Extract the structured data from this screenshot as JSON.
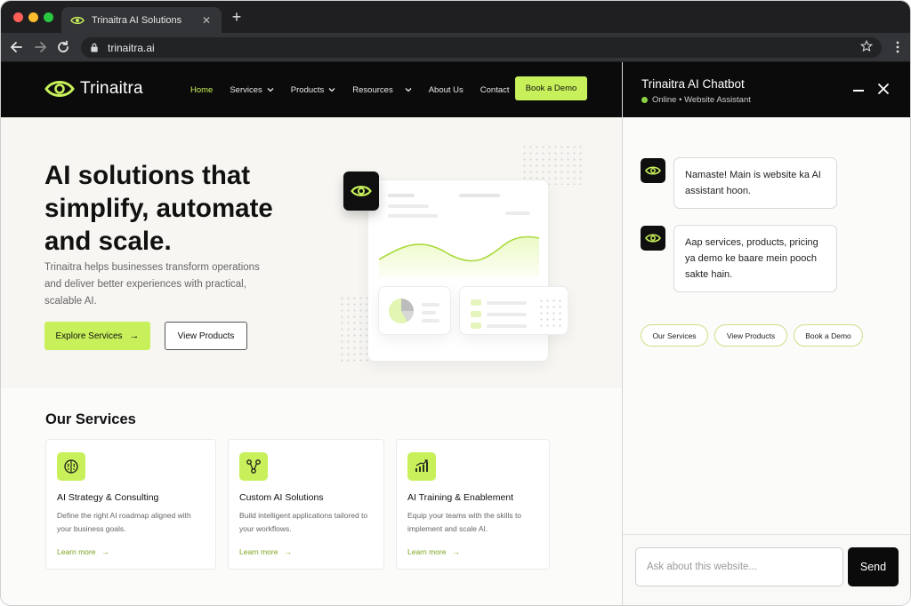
{
  "browser": {
    "tab_title": "Trinaitra AI Solutions",
    "tab_close": "✕",
    "new_tab": "+",
    "url": "trinaitra.ai",
    "icons": [
      "back-icon",
      "forward-icon",
      "reload-icon",
      "lock-icon",
      "star-icon",
      "more-icon"
    ]
  },
  "site": {
    "brand": "Trinaitra",
    "accent_color": "#c8f05a",
    "nav": {
      "home": "Home",
      "services": "Services",
      "products": "Products",
      "resources": "Resources",
      "about": "About Us",
      "contact": "Contact"
    },
    "cta": "Book a Demo"
  },
  "hero": {
    "title": "AI solutions that simplify, automate and scale.",
    "subtitle": "Trinaitra helps businesses transform operations and deliver better experiences with practical, scalable AI.",
    "primary_button": "Explore Services",
    "primary_arrow": "→",
    "secondary_button": "View Products"
  },
  "services": {
    "heading": "Our Services",
    "items": [
      {
        "name": "AI Strategy & Consulting",
        "description": "Define the right AI roadmap aligned with your business goals.",
        "link": "Learn more",
        "arrow": "→",
        "icon": "brain-icon"
      },
      {
        "name": "Custom AI Solutions",
        "description": "Build intelligent applications tailored to your workflows.",
        "link": "Learn more",
        "arrow": "→",
        "icon": "nodes-icon"
      },
      {
        "name": "AI Training & Enablement",
        "description": "Equip your teams with the skills to implement and scale AI.",
        "link": "Learn more",
        "arrow": "→",
        "icon": "growth-chart-icon"
      }
    ]
  },
  "chat": {
    "title": "Trinaitra AI Chatbot",
    "status": "Online • Website Assistant",
    "messages": [
      {
        "text": "Namaste! Main is website ka AI assistant hoon."
      },
      {
        "text": "Aap services, products, pricing ya demo ke baare mein pooch sakte hain."
      }
    ],
    "quick_replies": [
      "Our Services",
      "View Products",
      "Book a Demo"
    ],
    "input_placeholder": "Ask about this website...",
    "send_label": "Send"
  }
}
